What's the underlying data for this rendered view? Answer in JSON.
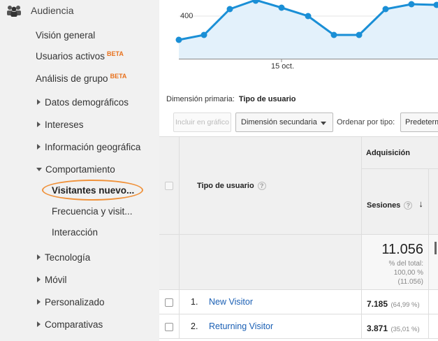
{
  "sidebar": {
    "section_label": "Audiencia",
    "section_icon": "people-icon",
    "items": [
      {
        "label": "Visión general"
      },
      {
        "label": "Usuarios activos",
        "badge": "BETA"
      },
      {
        "label": "Análisis de grupo",
        "badge": "BETA"
      },
      {
        "label": "Datos demográficos",
        "expandable": true
      },
      {
        "label": "Intereses",
        "expandable": true
      },
      {
        "label": "Información geográfica",
        "expandable": true
      },
      {
        "label": "Comportamiento",
        "expanded": true
      },
      {
        "label": "Tecnología",
        "expandable": true
      },
      {
        "label": "Móvil",
        "expandable": true
      },
      {
        "label": "Personalizado",
        "expandable": true
      },
      {
        "label": "Comparativas",
        "expandable": true
      }
    ],
    "sub_items": [
      {
        "label": "Visitantes nuevo...",
        "active": true
      },
      {
        "label": "Frecuencia y visit..."
      },
      {
        "label": "Interacción"
      }
    ],
    "highlight_color": "#f0923b"
  },
  "chart": {
    "y_tick": "400",
    "x_tick": "15 oct.",
    "line_color": "#1a8fd6",
    "fill_color": "#e3f1fb"
  },
  "primary_dimension": {
    "label": "Dimensión primaria:",
    "value": "Tipo de usuario"
  },
  "toolbar": {
    "plot_button": "Incluir en gráfico",
    "secondary_dimension": "Dimensión secundaria",
    "sort_label": "Ordenar por tipo:",
    "sort_value": "Predeterm"
  },
  "table": {
    "group_header": "Adquisición",
    "dimension_header": "Tipo de usuario",
    "metric_header": "Sesiones",
    "totals": {
      "value": "11.056",
      "pct_label": "% del total:",
      "pct_value": "100,00 %",
      "abs": "(11.056)"
    },
    "rows": [
      {
        "index": "1.",
        "name": "New Visitor",
        "sessions": "7.185",
        "pct": "(64,99 %)"
      },
      {
        "index": "2.",
        "name": "Returning Visitor",
        "sessions": "3.871",
        "pct": "(35,01 %)"
      }
    ]
  }
}
